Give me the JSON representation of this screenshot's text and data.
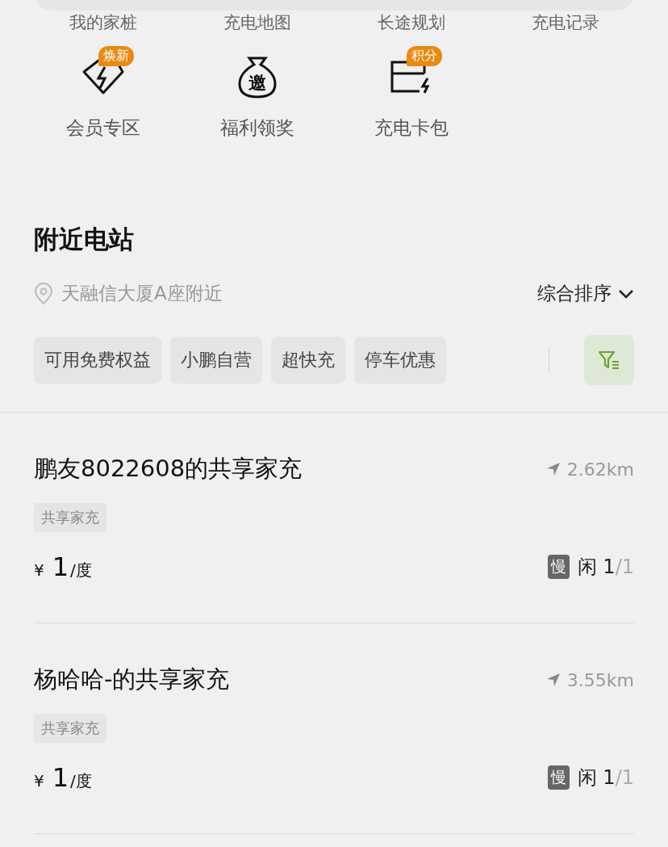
{
  "quick_actions_top": [
    "我的家桩",
    "充电地图",
    "长途规划",
    "充电记录"
  ],
  "quick_actions": [
    {
      "kind": "member",
      "label": "会员专区",
      "badge": "焕新"
    },
    {
      "kind": "bag",
      "label": "福利领奖",
      "glyph": "邀"
    },
    {
      "kind": "card",
      "label": "充电卡包",
      "badge": "积分"
    }
  ],
  "nearby": {
    "title": "附近电站",
    "location": "天融信大厦A座附近",
    "sort": "综合排序",
    "filters": [
      {
        "label": "可用免费权益",
        "selected": false
      },
      {
        "label": "小鹏自营",
        "selected": false
      },
      {
        "label": "超快充",
        "selected": false
      },
      {
        "label": "停车优惠",
        "selected": false
      }
    ]
  },
  "stations": [
    {
      "name": "鹏友8022608的共享家充",
      "distance": "2.62km",
      "tag": "共享家充",
      "currency": "¥",
      "price": "1",
      "unit": "/度",
      "speed": "慢",
      "status": "闲",
      "free": "1",
      "total": "/1"
    },
    {
      "name": "杨哈哈-的共享家充",
      "distance": "3.55km",
      "tag": "共享家充",
      "currency": "¥",
      "price": "1",
      "unit": "/度",
      "speed": "慢",
      "status": "闲",
      "free": "1",
      "total": "/1"
    }
  ]
}
